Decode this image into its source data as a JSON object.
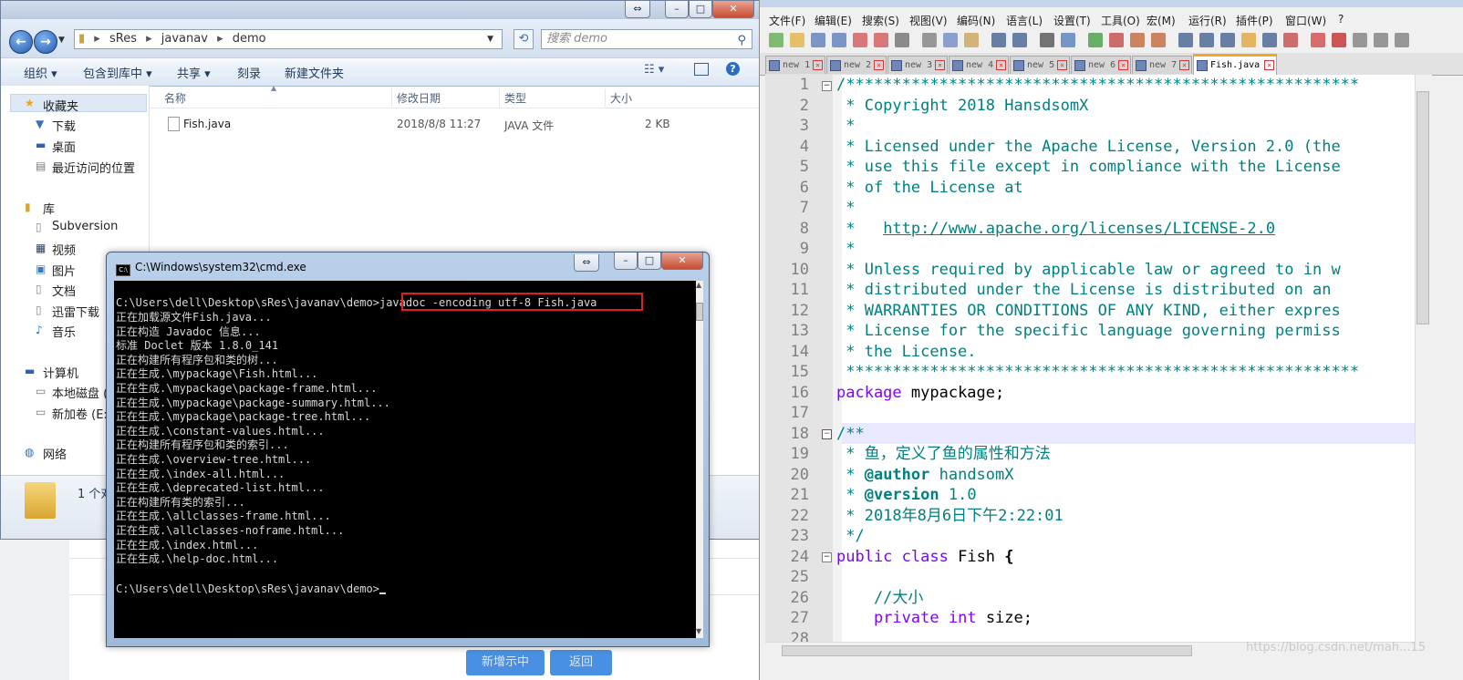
{
  "background_page": {
    "button_add": "新增示中",
    "button_back": "返回"
  },
  "explorer": {
    "path": [
      "sRes",
      "javanav",
      "demo"
    ],
    "search_placeholder": "搜索 demo",
    "toolbar": [
      "组织 ▾",
      "包含到库中 ▾",
      "共享 ▾",
      "刻录",
      "新建文件夹"
    ],
    "sidebar": {
      "favorites_title": "收藏夹",
      "favorites": [
        "下载",
        "桌面",
        "最近访问的位置"
      ],
      "libraries_title": "库",
      "libraries": [
        "Subversion",
        "视频",
        "图片",
        "文档",
        "迅雷下载",
        "音乐"
      ],
      "computer_title": "计算机",
      "drives": [
        "本地磁盘 (C",
        "新加卷 (E:)"
      ],
      "network_title": "网络"
    },
    "columns": [
      "名称",
      "修改日期",
      "类型",
      "大小"
    ],
    "files": [
      {
        "name": "Fish.java",
        "modified": "2018/8/8 11:27",
        "type": "JAVA 文件",
        "size": "2 KB"
      }
    ],
    "status_text": "1 个对"
  },
  "cmd": {
    "title": "C:\\Windows\\system32\\cmd.exe",
    "prompt": "C:\\Users\\dell\\Desktop\\sRes\\javanav\\demo>",
    "command": "javadoc -encoding utf-8 Fish.java",
    "output": [
      "正在加载源文件Fish.java...",
      "正在构造 Javadoc 信息...",
      "标准 Doclet 版本 1.8.0_141",
      "正在构建所有程序包和类的树...",
      "正在生成.\\mypackage\\Fish.html...",
      "正在生成.\\mypackage\\package-frame.html...",
      "正在生成.\\mypackage\\package-summary.html...",
      "正在生成.\\mypackage\\package-tree.html...",
      "正在生成.\\constant-values.html...",
      "正在构建所有程序包和类的索引...",
      "正在生成.\\overview-tree.html...",
      "正在生成.\\index-all.html...",
      "正在生成.\\deprecated-list.html...",
      "正在构建所有类的索引...",
      "正在生成.\\allclasses-frame.html...",
      "正在生成.\\allclasses-noframe.html...",
      "正在生成.\\index.html...",
      "正在生成.\\help-doc.html..."
    ],
    "final_prompt": "C:\\Users\\dell\\Desktop\\sRes\\javanav\\demo>"
  },
  "notepad": {
    "menu": [
      "文件(F)",
      "编辑(E)",
      "搜索(S)",
      "视图(V)",
      "编码(N)",
      "语言(L)",
      "设置(T)",
      "工具(O)",
      "宏(M)",
      "运行(R)",
      "插件(P)",
      "窗口(W)",
      "?"
    ],
    "tabs": [
      "new 1",
      "new 2",
      "new 3",
      "new 4",
      "new 5",
      "new 6",
      "new 7",
      "Fish.java"
    ],
    "active_tab": "Fish.java",
    "line_numbers": [
      "1",
      "2",
      "3",
      "4",
      "5",
      "6",
      "7",
      "8",
      "9",
      "10",
      "11",
      "12",
      "13",
      "14",
      "15",
      "16",
      "17",
      "18",
      "19",
      "20",
      "21",
      "22",
      "23",
      "24",
      "25",
      "26",
      "27",
      "28"
    ],
    "code": {
      "l1": "/*******************************************************",
      "l2": " * Copyright 2018 HansdsomX",
      "l3": " *",
      "l4": " * Licensed under the Apache License, Version 2.0 (the",
      "l5": " * use this file except in compliance with the License",
      "l6": " * of the License at",
      "l7": " *",
      "l8_prefix": " *   ",
      "l8_url": "http://www.apache.org/licenses/LICENSE-2.0",
      "l9": " *",
      "l10": " * Unless required by applicable law or agreed to in w",
      "l11": " * distributed under the License is distributed on an",
      "l12": " * WARRANTIES OR CONDITIONS OF ANY KIND, either expres",
      "l13": " * License for the specific language governing permiss",
      "l14": " * the License.",
      "l15": " *******************************************************",
      "l16_kw": "package",
      "l16_rest": " mypackage;",
      "l18": "/**",
      "l19": " * 鱼，定义了鱼的属性和方法",
      "l20_pre": " * ",
      "l20_tag": "@author",
      "l20_rest": " handsomX",
      "l21_pre": " * ",
      "l21_tag": "@version",
      "l21_rest": " 1.0",
      "l22": " * 2018年8月6日下午2:22:01",
      "l23": " */",
      "l24_kw1": "public",
      "l24_kw2": "class",
      "l24_name": " Fish ",
      "l24_brace": "{",
      "l26": "    //大小",
      "l27_kw1": "private",
      "l27_kw2": "int",
      "l27_rest": " size;"
    },
    "watermark": "https://blog.csdn.net/mah...15"
  }
}
